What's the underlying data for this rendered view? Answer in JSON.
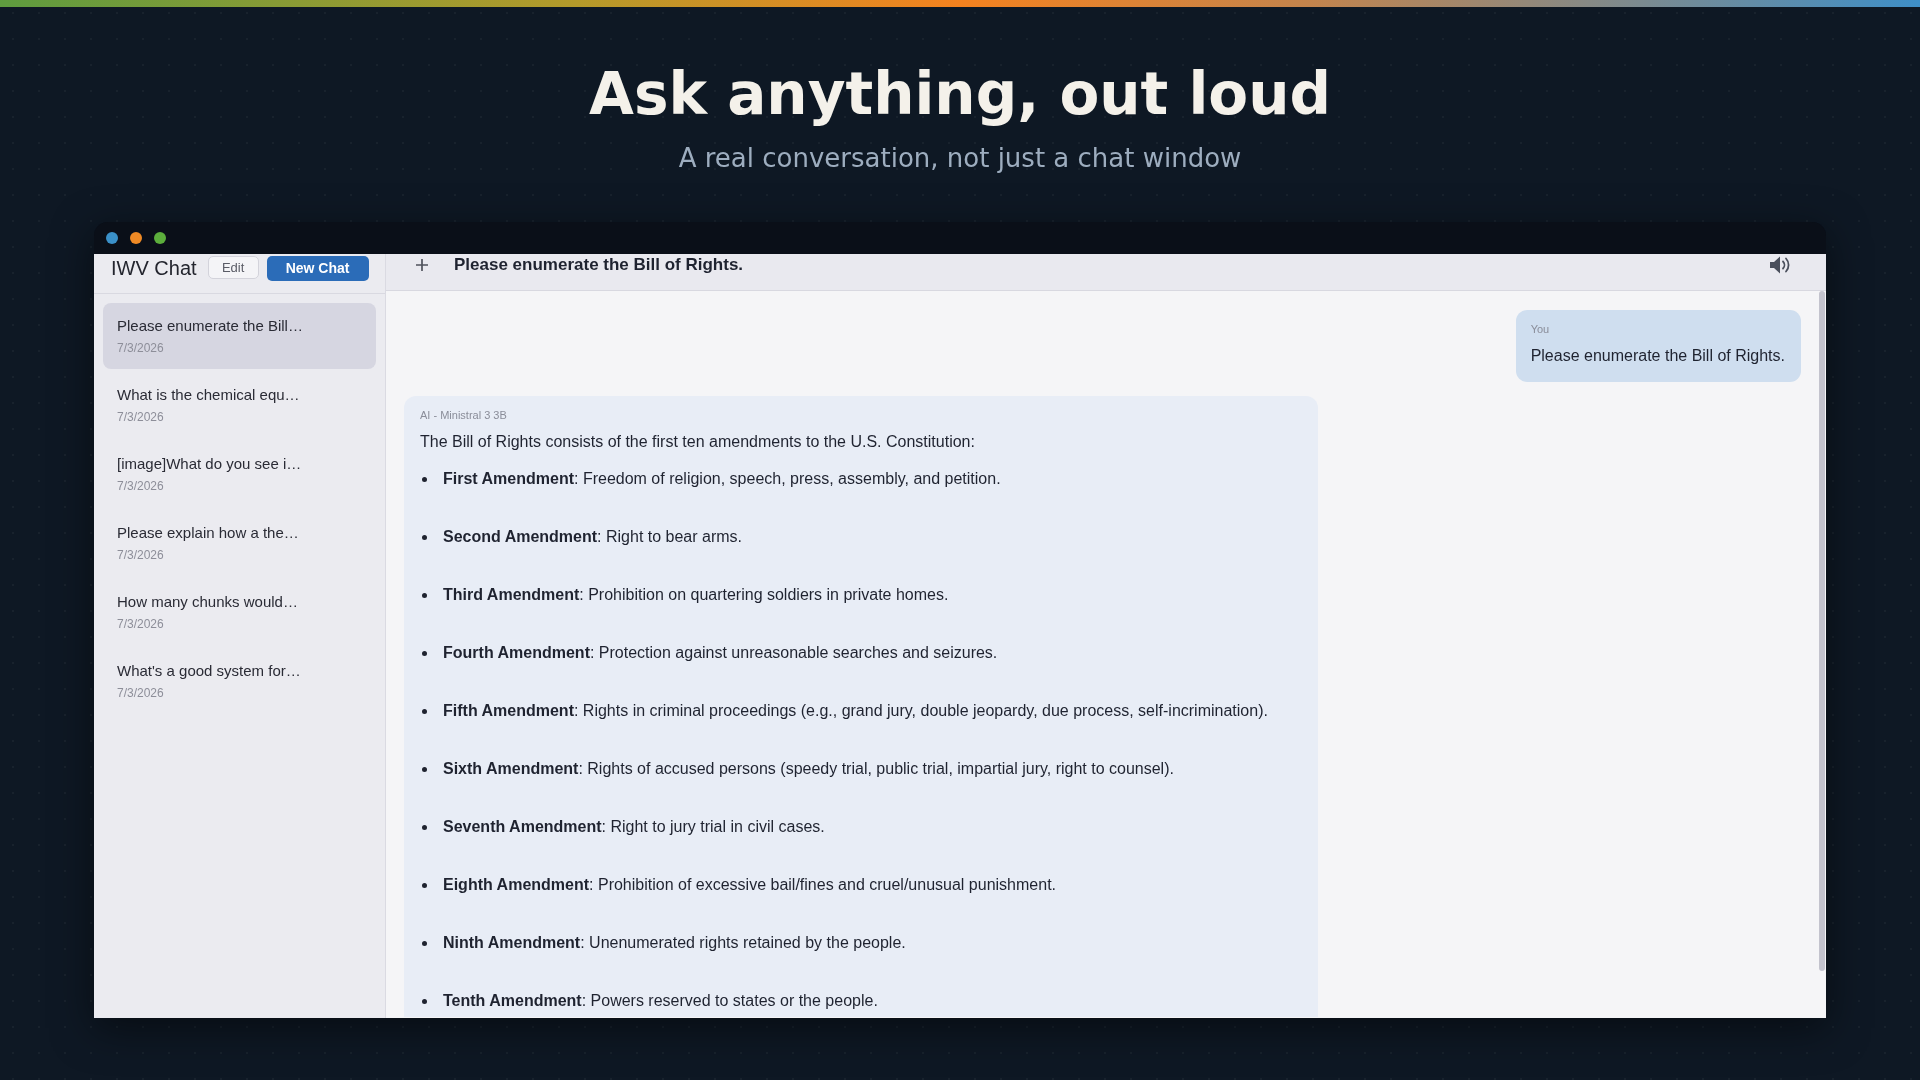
{
  "hero": {
    "title": "Ask anything, out loud",
    "subtitle": "A real conversation, not just a chat window"
  },
  "app_window": {
    "sidebar": {
      "title": "IWV Chat",
      "edit_button": "Edit",
      "new_chat_button": "New Chat",
      "conversations": [
        {
          "title": "Please enumerate the Bill…",
          "date": "7/3/2026",
          "selected": true
        },
        {
          "title": "What is the chemical equ…",
          "date": "7/3/2026",
          "selected": false
        },
        {
          "title": "[image]What do you see i…",
          "date": "7/3/2026",
          "selected": false
        },
        {
          "title": "Please explain how a the…",
          "date": "7/3/2026",
          "selected": false
        },
        {
          "title": "How many chunks would…",
          "date": "7/3/2026",
          "selected": false
        },
        {
          "title": "What's a good system for…",
          "date": "7/3/2026",
          "selected": false
        }
      ]
    },
    "chat": {
      "title": "Please enumerate the Bill of Rights.",
      "messages": [
        {
          "kind": "user",
          "sender": "You",
          "text": "Please enumerate the Bill of Rights."
        },
        {
          "kind": "assistant",
          "sender": "AI - Ministral 3 3B",
          "text": "The Bill of Rights consists of the first ten amendments to the U.S. Constitution:",
          "bullets": [
            "**First Amendment**: Freedom of religion, speech, press, assembly, and petition.",
            "**Second Amendment**: Right to bear arms.",
            "**Third Amendment**: Prohibition on quartering soldiers in private homes.",
            "**Fourth Amendment**: Protection against unreasonable searches and seizures.",
            "**Fifth Amendment**: Rights in criminal proceedings (e.g., grand jury, double jeopardy, due process, self-incrimination).",
            "**Sixth Amendment**: Rights of accused persons (speedy trial, public trial, impartial jury, right to counsel).",
            "**Seventh Amendment**: Right to jury trial in civil cases.",
            "**Eighth Amendment**: Prohibition of excessive bail/fines and cruel/unusual punishment.",
            "**Ninth Amendment**: Unenumerated rights retained by the people.",
            "**Tenth Amendment**: Powers reserved to states or the people."
          ]
        }
      ]
    }
  }
}
